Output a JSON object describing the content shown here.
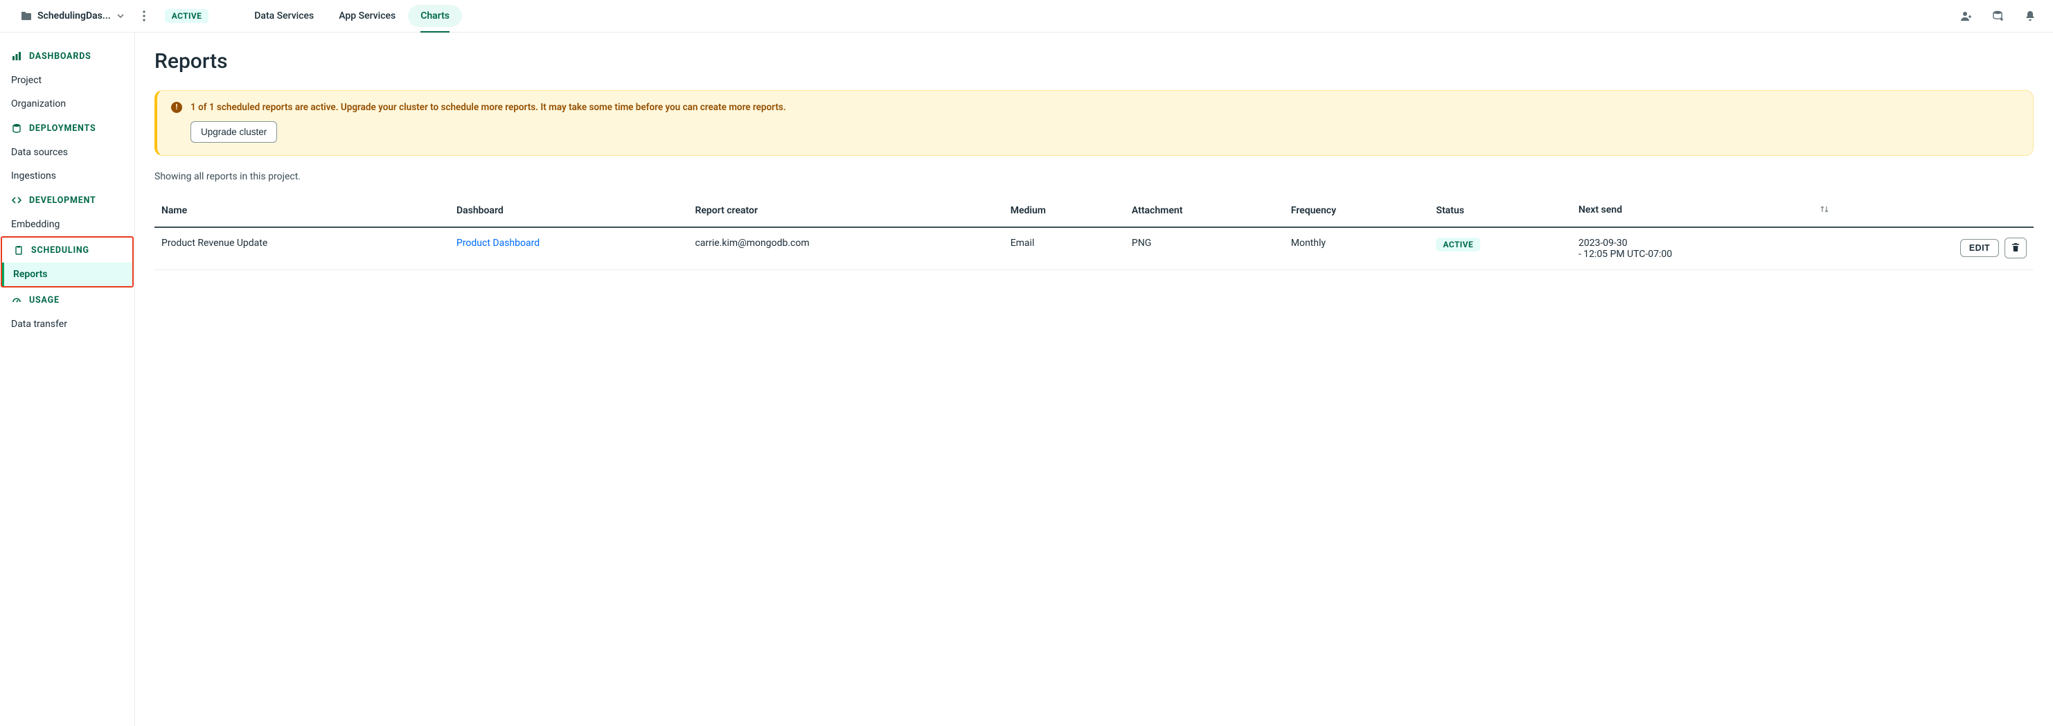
{
  "header": {
    "project_name": "SchedulingDas...",
    "status_badge": "ACTIVE",
    "tabs": [
      {
        "label": "Data Services",
        "active": false
      },
      {
        "label": "App Services",
        "active": false
      },
      {
        "label": "Charts",
        "active": true
      }
    ]
  },
  "sidebar": {
    "sections": [
      {
        "title": "DASHBOARDS",
        "icon": "bar-chart-icon",
        "items": [
          {
            "label": "Project"
          },
          {
            "label": "Organization"
          }
        ]
      },
      {
        "title": "DEPLOYMENTS",
        "icon": "database-icon",
        "items": [
          {
            "label": "Data sources"
          },
          {
            "label": "Ingestions"
          }
        ]
      },
      {
        "title": "DEVELOPMENT",
        "icon": "code-icon",
        "items": [
          {
            "label": "Embedding"
          }
        ]
      },
      {
        "title": "SCHEDULING",
        "icon": "clipboard-icon",
        "highlighted": true,
        "items": [
          {
            "label": "Reports",
            "active": true
          }
        ]
      },
      {
        "title": "USAGE",
        "icon": "gauge-icon",
        "items": [
          {
            "label": "Data transfer"
          }
        ]
      }
    ]
  },
  "page": {
    "title": "Reports",
    "alert": {
      "text": "1 of 1 scheduled reports are active. Upgrade your cluster to schedule more reports. It may take some time before you can create more reports.",
      "button": "Upgrade cluster"
    },
    "subtitle": "Showing all reports in this project.",
    "columns": {
      "name": "Name",
      "dashboard": "Dashboard",
      "creator": "Report creator",
      "medium": "Medium",
      "attachment": "Attachment",
      "frequency": "Frequency",
      "status": "Status",
      "next_send": "Next send"
    },
    "rows": [
      {
        "name": "Product Revenue Update",
        "dashboard": "Product Dashboard",
        "creator": "carrie.kim@mongodb.com",
        "medium": "Email",
        "attachment": "PNG",
        "frequency": "Monthly",
        "status": "ACTIVE",
        "next_send_line1": "2023-09-30",
        "next_send_line2": "- 12:05 PM UTC-07:00",
        "edit_label": "EDIT"
      }
    ]
  }
}
